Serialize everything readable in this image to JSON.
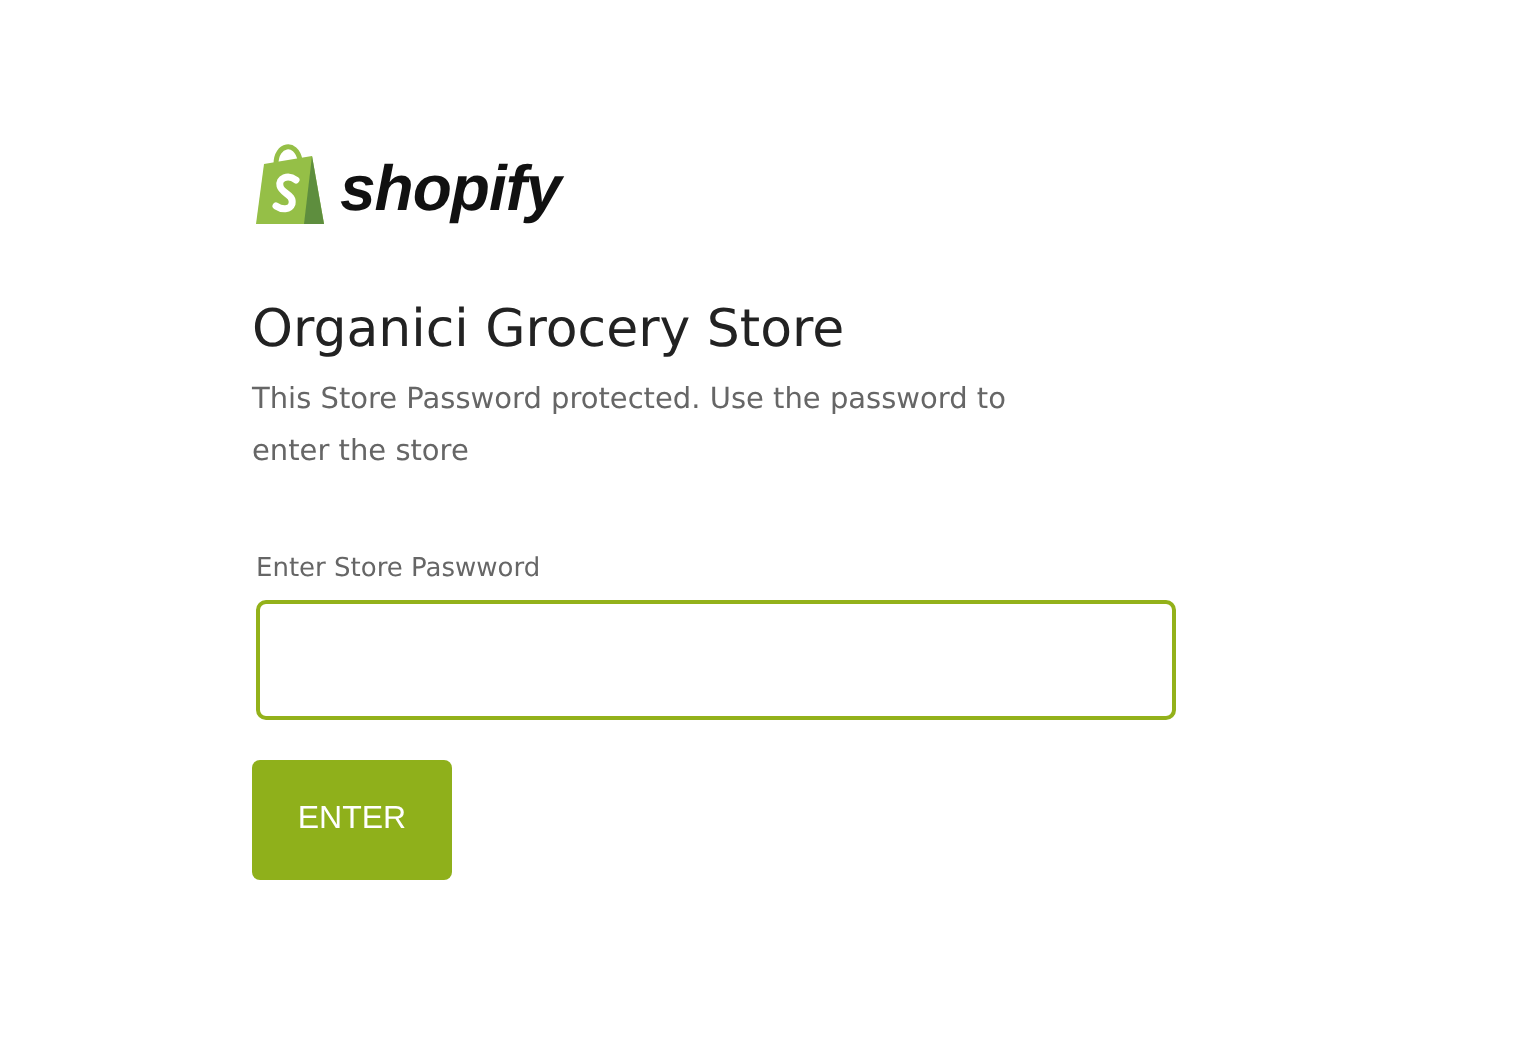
{
  "logo": {
    "wordmark": "shopify"
  },
  "store_name": "Organici Grocery Store",
  "message": "This Store Password protected. Use the password to enter the store",
  "password_field": {
    "label": "Enter Store Paswword"
  },
  "enter_button": {
    "label": "ENTER"
  }
}
